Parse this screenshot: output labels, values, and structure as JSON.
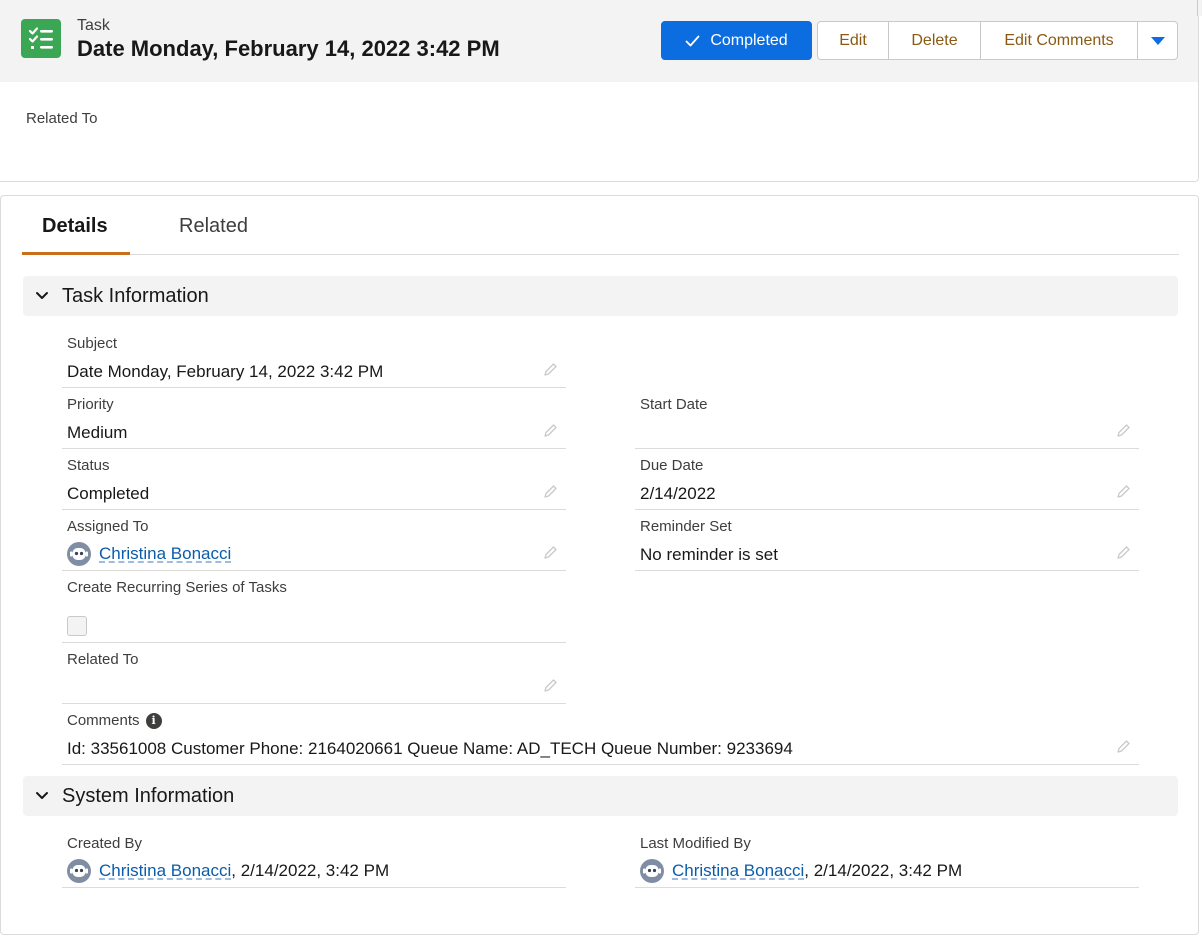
{
  "header": {
    "object_label": "Task",
    "title": "Date Monday, February 14, 2022 3:42 PM",
    "icon": "task-list-icon",
    "actions": {
      "completed": "Completed",
      "edit": "Edit",
      "delete": "Delete",
      "edit_comments": "Edit Comments"
    },
    "highlights_related_to_label": "Related To"
  },
  "tabs": {
    "details": "Details",
    "related": "Related",
    "active": "Details"
  },
  "task_information": {
    "title": "Task Information",
    "subject": {
      "label": "Subject",
      "value": "Date Monday, February 14, 2022 3:42 PM"
    },
    "priority": {
      "label": "Priority",
      "value": "Medium"
    },
    "start_date": {
      "label": "Start Date",
      "value": ""
    },
    "status": {
      "label": "Status",
      "value": "Completed"
    },
    "due_date": {
      "label": "Due Date",
      "value": "2/14/2022"
    },
    "assigned_to": {
      "label": "Assigned To",
      "value": "Christina Bonacci"
    },
    "reminder_set": {
      "label": "Reminder Set",
      "value": "No reminder is set"
    },
    "recurring": {
      "label": "Create Recurring Series of Tasks",
      "checked": false
    },
    "related_to": {
      "label": "Related To",
      "value": ""
    },
    "comments": {
      "label": "Comments",
      "value": "Id: 33561008 Customer Phone: 2164020661 Queue Name: AD_TECH Queue Number: 9233694"
    }
  },
  "system_information": {
    "title": "System Information",
    "created_by": {
      "label": "Created By",
      "user": "Christina Bonacci",
      "date": ", 2/14/2022, 3:42 PM"
    },
    "last_modified_by": {
      "label": "Last Modified By",
      "user": "Christina Bonacci",
      "date": ", 2/14/2022, 3:42 PM"
    }
  },
  "colors": {
    "brand": "#0b6ddf",
    "task_icon": "#3ba755",
    "active_tab": "#c96f1b",
    "link": "#0b5cab"
  }
}
